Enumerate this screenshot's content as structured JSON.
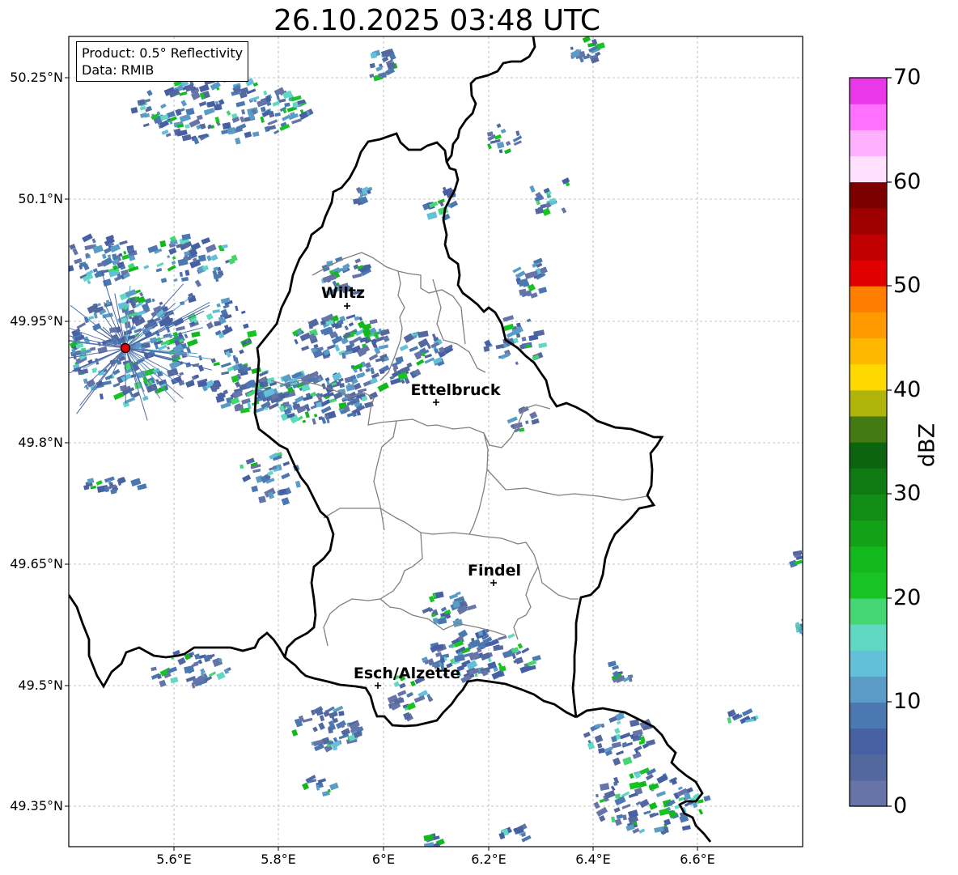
{
  "title": "26.10.2025 03:48 UTC",
  "info_box": {
    "product": "Product: 0.5° Reflectivity",
    "data": "Data: RMIB"
  },
  "lat_ticks": [
    "50.25°N",
    "50.1°N",
    "49.95°N",
    "49.8°N",
    "49.65°N",
    "49.5°N",
    "49.35°N"
  ],
  "lon_ticks": [
    "5.6°E",
    "5.8°E",
    "6°E",
    "6.2°E",
    "6.4°E",
    "6.6°E"
  ],
  "colorbar": {
    "label": "dBZ",
    "ticks": [
      "70",
      "60",
      "50",
      "40",
      "30",
      "20",
      "10",
      "0"
    ],
    "colors_bottom_to_top": [
      "#6674a8",
      "#5468a0",
      "#4760a4",
      "#4b78b0",
      "#5a9cc6",
      "#62c1d8",
      "#61d8c2",
      "#44d673",
      "#18c424",
      "#12b81c",
      "#13a217",
      "#128e16",
      "#0f7a12",
      "#0d6410",
      "#447a12",
      "#b0b40a",
      "#ffd800",
      "#ffb800",
      "#ff9a00",
      "#ff7e00",
      "#e00000",
      "#c00000",
      "#9e0000",
      "#7c0000",
      "#ffe0ff",
      "#ffb0ff",
      "#ff70ff",
      "#e838e8"
    ]
  },
  "cities": [
    {
      "name": "Wiltz"
    },
    {
      "name": "Ettelbruck"
    },
    {
      "name": "Findel"
    },
    {
      "name": "Esch/Alzette"
    }
  ],
  "map_extent": {
    "lon": [
      5.4,
      6.8
    ],
    "lat": [
      49.3,
      50.3
    ]
  }
}
